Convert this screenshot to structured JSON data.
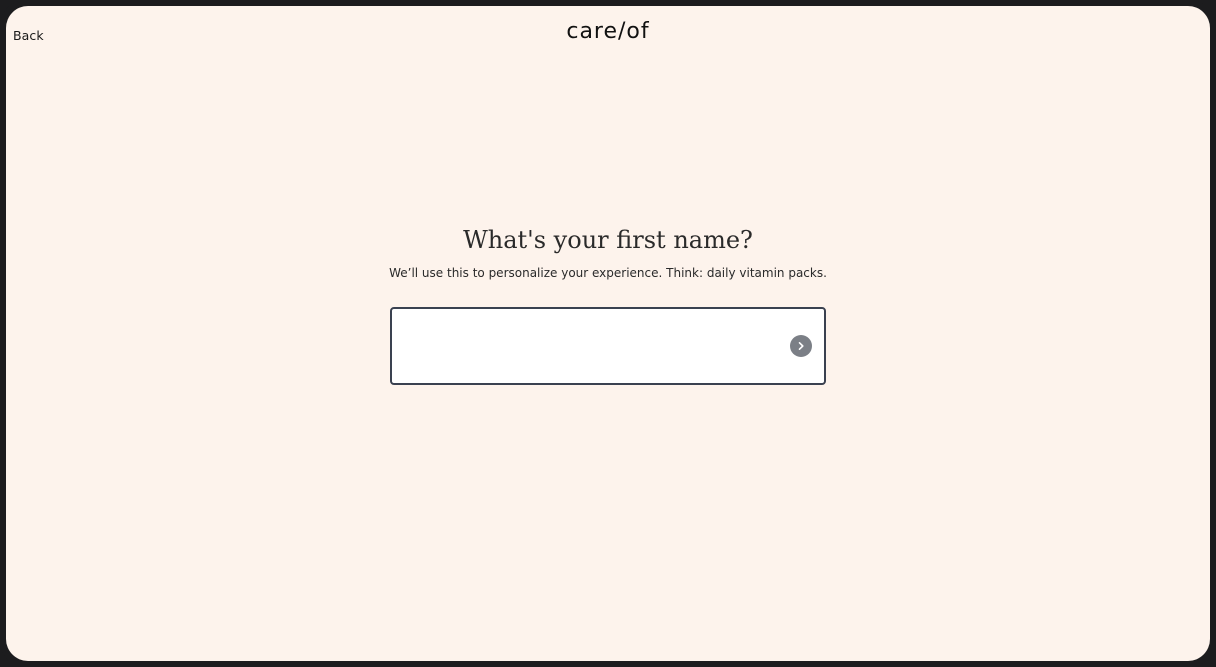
{
  "nav": {
    "back_label": "Back"
  },
  "brand": {
    "logo_text": "care/of"
  },
  "question": {
    "title": "What's your first name?",
    "subtitle": "We’ll use this to personalize your experience. Think: daily vitamin packs."
  },
  "name_field": {
    "value": "",
    "placeholder": ""
  },
  "icons": {
    "submit": "chevron-right-icon"
  },
  "colors": {
    "background": "#fdf3ec",
    "field_border": "#3a4150",
    "submit_button": "#7b7f86"
  }
}
